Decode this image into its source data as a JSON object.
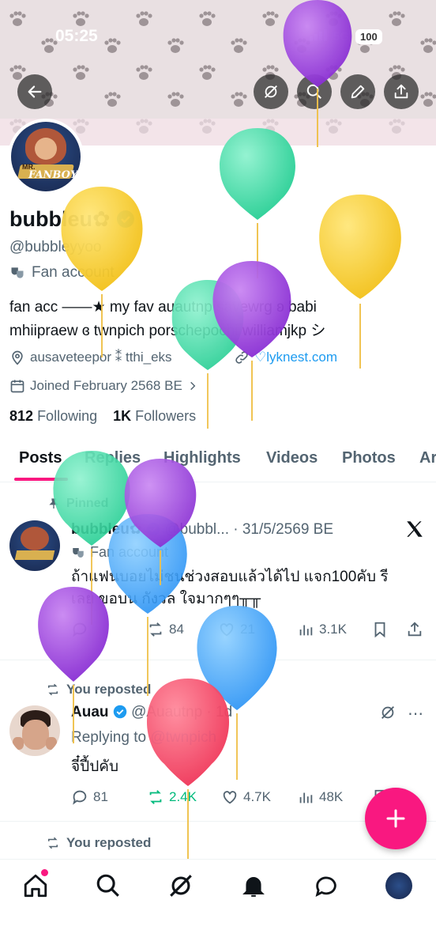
{
  "status_bar": {
    "time": "05:25",
    "network": "5G",
    "battery": "100"
  },
  "header": {
    "back_icon": "arrow-left-icon",
    "actions": [
      "grok-icon",
      "search-icon",
      "edit-icon",
      "share-icon"
    ]
  },
  "profile": {
    "display_name": "bubbleu✿",
    "verified": true,
    "handle": "@bubbleyyoo",
    "label": "Fan account",
    "bio_line1": "fan acc ——★ my fav auautnp savewrg ʚ babi",
    "bio_line2": "mhiipraew ɞ twnpich porschepochi williamjkp シ",
    "location": "ausaveteepor ⁑ tthi_eks",
    "website": "♡lyknest.com",
    "joined": "Joined February 2568 BE",
    "following_count": "812",
    "following_label": "Following",
    "followers_count": "1K",
    "followers_label": "Followers",
    "avatar_text": "FANBOY",
    "avatar_text_small": "MR."
  },
  "tabs": [
    "Posts",
    "Replies",
    "Highlights",
    "Videos",
    "Photos",
    "Ar"
  ],
  "tweet1": {
    "pinned_label": "Pinned",
    "name": "bubbleu✿",
    "handle_time": "@bubbl... · 31/5/2569 BE",
    "sub_label": "Fan account",
    "text_line1": "ถ้าแฟนบอยไม่ชนช่วงสอบแล้วได้ไป แจก100คับ รี",
    "text_line2": "เลย ขอบน กังวล ใจมากๆๆ╥╥",
    "reposts": "84",
    "likes": "21",
    "views": "3.1K"
  },
  "tweet2": {
    "repost_label": "You reposted",
    "name": "Auau",
    "handle": "@Auautnp · 1d",
    "replying_prefix": "Replying to",
    "replying_to": "@twnpich",
    "text": "จี๋ปี้ปคับ",
    "replies": "81",
    "reposts": "2.4K",
    "likes": "4.7K",
    "views": "48K"
  },
  "tweet3": {
    "repost_label": "You reposted"
  },
  "bottom_nav": [
    "home-icon",
    "search-icon",
    "grok-icon",
    "notifications-icon",
    "messages-icon",
    "profile-avatar"
  ],
  "colors": {
    "accent": "#1d9bf0",
    "tab_underline": "#f91880",
    "fab": "#f91880",
    "repost_green": "#00ba7c"
  }
}
